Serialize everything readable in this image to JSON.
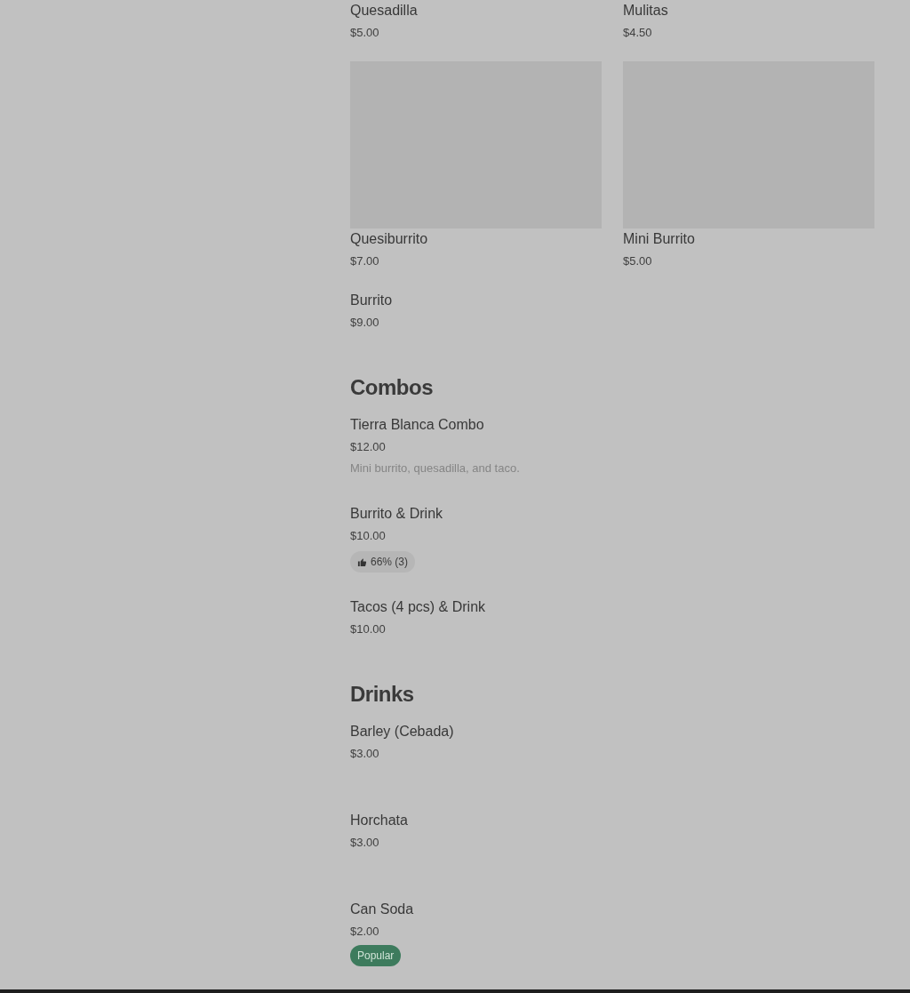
{
  "grid_items": [
    {
      "kind": "text",
      "name": "Quesadilla",
      "price": "$5.00"
    },
    {
      "kind": "text",
      "name": "Mulitas",
      "price": "$4.50"
    },
    {
      "kind": "picture",
      "name": "Quesiburrito",
      "price": "$7.00"
    },
    {
      "kind": "picture",
      "name": "Mini Burrito",
      "price": "$5.00"
    },
    {
      "kind": "text",
      "name": "Burrito",
      "price": "$9.00"
    }
  ],
  "sections": [
    {
      "title": "Combos",
      "items": [
        {
          "name": "Tierra Blanca Combo",
          "price": "$12.00",
          "description": "Mini burrito, quesadilla, and taco."
        },
        {
          "name": "Burrito & Drink",
          "price": "$10.00",
          "badge": {
            "kind": "rating",
            "text": "66% (3)"
          }
        },
        {
          "name": "Tacos (4 pcs) & Drink",
          "price": "$10.00"
        }
      ]
    },
    {
      "title": "Drinks",
      "items": [
        {
          "name": "Barley (Cebada)",
          "price": "$3.00"
        },
        {
          "name": "Horchata",
          "price": "$3.00"
        },
        {
          "name": "Can Soda",
          "price": "$2.00",
          "badge": {
            "kind": "popular",
            "text": "Popular"
          }
        }
      ]
    }
  ]
}
